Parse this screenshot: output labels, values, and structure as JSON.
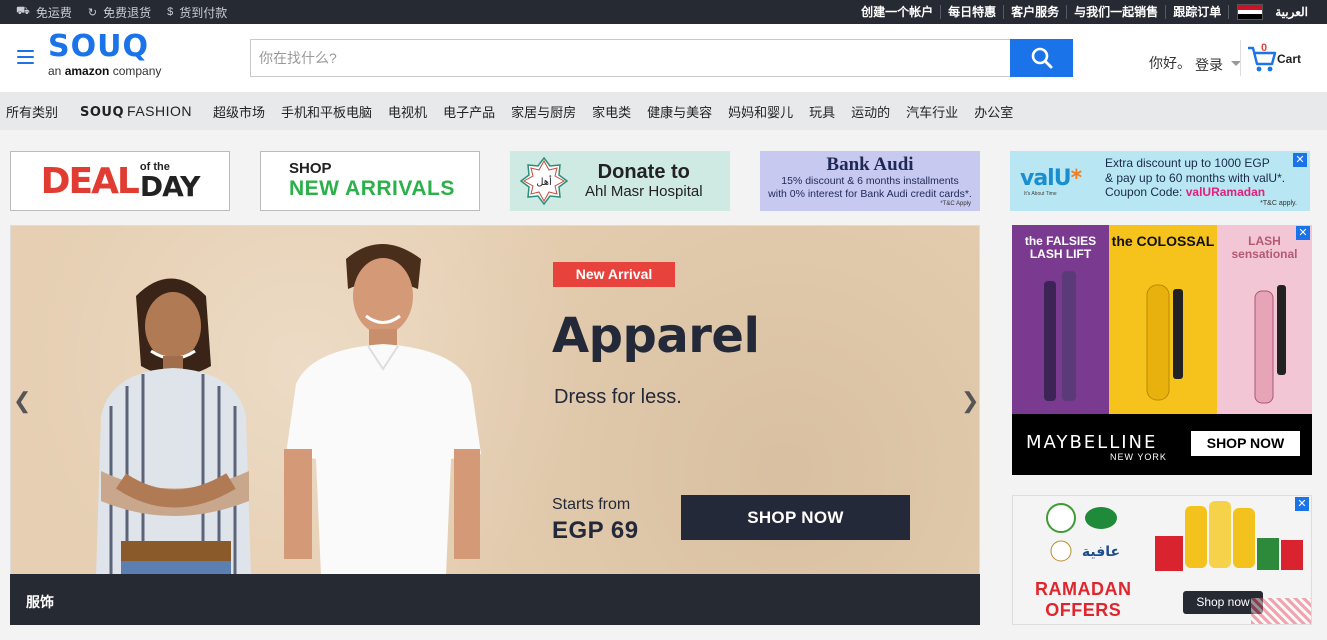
{
  "topbar": {
    "left": [
      {
        "icon": "truck-icon",
        "label": "免运费"
      },
      {
        "icon": "refresh-icon",
        "label": "免费退货"
      },
      {
        "icon": "dollar-icon",
        "label": "货到付款"
      }
    ],
    "right": [
      "创建一个帐户",
      "每日特惠",
      "客户服务",
      "与我们一起销售",
      "跟踪订单"
    ],
    "language": "العربية",
    "flag_colors": [
      "#ce1126",
      "#ffffff",
      "#000000"
    ]
  },
  "header": {
    "logo_text": "SOUQ",
    "logo_tagline_prefix": "an ",
    "logo_tagline_brand": "amazon",
    "logo_tagline_suffix": " company",
    "search_placeholder": "你在找什么?",
    "greeting": "你好。",
    "login": "登录",
    "cart_count": "0",
    "cart_label": "Cart"
  },
  "nav": {
    "all_categories": "所有类别",
    "fashion_brand": "SOUQ",
    "fashion_word": "FASHION",
    "items": [
      "超级市场",
      "手机和平板电脑",
      "电视机",
      "电子产品",
      "家居与厨房",
      "家电类",
      "健康与美容",
      "妈妈和婴儿",
      "玩具",
      "运动的",
      "汽车行业",
      "办公室"
    ]
  },
  "promos": {
    "deal": {
      "big": "DEAL",
      "of_the": "of the",
      "day": "DAY"
    },
    "arrivals": {
      "shop": "SHOP",
      "new_arrivals": "NEW ARRIVALS"
    },
    "donate": {
      "line1": "Donate to",
      "line2": "Ahl Masr Hospital"
    },
    "bank": {
      "name": "Bank Audi",
      "line1": "15% discount & 6 months installments",
      "line2": "with 0% interest for Bank Audi credit cards*.",
      "tc": "*T&C Apply"
    },
    "valu": {
      "logo": "valU",
      "star": "*",
      "tagline": "It's About Time",
      "line1": "Extra discount up to 1000 EGP",
      "line2": "& pay up to 60 months with valU*.",
      "coupon_label": "Coupon Code: ",
      "coupon": "valURamadan",
      "tc": "*T&C apply."
    }
  },
  "hero": {
    "badge": "New Arrival",
    "title": "Apparel",
    "subtitle": "Dress for less.",
    "starts_from": "Starts from",
    "price": "EGP 69",
    "cta": "SHOP NOW",
    "caption": "服饰"
  },
  "ads": {
    "maybelline": {
      "products": [
        "the FALSIES LASH LIFT",
        "the COLOSSAL",
        "LASH sensational"
      ],
      "brand": "MAYBELLINE",
      "city": "NEW YORK",
      "cta": "SHOP NOW"
    },
    "ramadan": {
      "line1": "RAMADAN",
      "line2": "OFFERS",
      "cta": "Shop now"
    }
  },
  "colors": {
    "brand_blue": "#1a73e8",
    "dark": "#262a33",
    "accent_red": "#e8423d"
  }
}
